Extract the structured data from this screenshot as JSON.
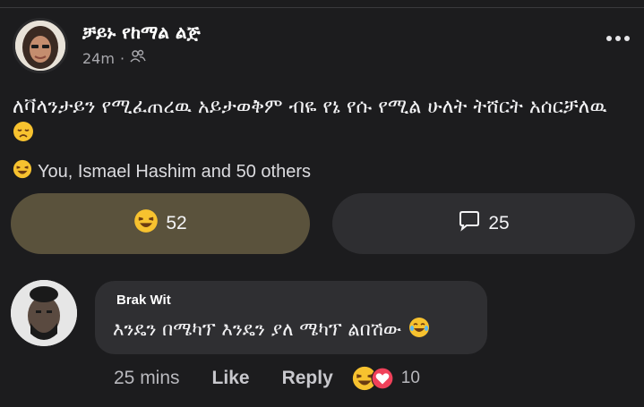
{
  "post": {
    "author": "ቻይኑ የከማል ልጅ",
    "time": "24m",
    "audience_icon": "friends-icon",
    "text": "ለቫላንታይን የሚፈጠረዉ አይታወቅም ብዬ የኔ የሱ የሚል ሁለት ትሸርት አሰርቻለዉ",
    "text_emoji": "disappointed-face-icon",
    "reactions_summary": "You, Ismael Hashim and 50 others",
    "reaction_count": "52",
    "comment_count": "25"
  },
  "comment": {
    "author": "Brak Wit",
    "text": "እንዴን በሜካፕ እንዴን ያለ ሜካፕ ልበሽው",
    "time": "25 mins",
    "like_label": "Like",
    "reply_label": "Reply",
    "reaction_count": "10"
  },
  "colors": {
    "background": "#1c1c1e",
    "react_pill": "#5a523c",
    "comment_pill": "#2e2e31",
    "bubble": "#2f2f32",
    "emoji_yellow": "#f7c22f",
    "heart_red": "#f0415a"
  }
}
